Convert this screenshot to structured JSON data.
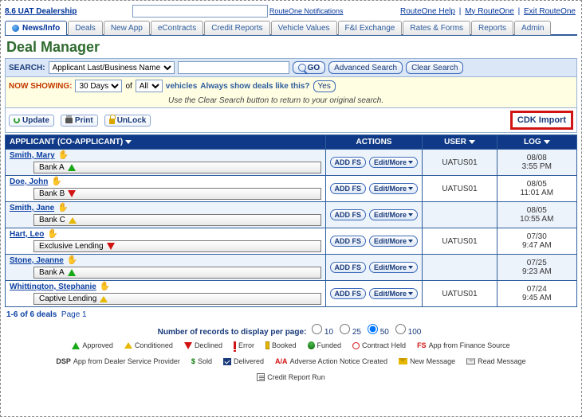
{
  "top": {
    "dealer": "8.6 UAT Dealership",
    "notif_label": "RouteOne Notifications",
    "links": {
      "help": "RouteOne Help",
      "my": "My RouteOne",
      "exit": "Exit RouteOne"
    }
  },
  "tabs": [
    "News/Info",
    "Deals",
    "New App",
    "eContracts",
    "Credit Reports",
    "Vehicle Values",
    "F&I Exchange",
    "Rates & Forms",
    "Reports",
    "Admin"
  ],
  "active_tab": 0,
  "title": "Deal Manager",
  "search": {
    "label": "SEARCH:",
    "field_sel": "Applicant Last/Business Name",
    "go": "GO",
    "advanced": "Advanced Search",
    "clear": "Clear Search"
  },
  "nowshow": {
    "label": "NOW SHOWING:",
    "range": "30 Days",
    "of": "of",
    "filter": "All",
    "vehicles": "vehicles",
    "question": "Always show deals like this?",
    "yes": "Yes",
    "hint": "Use the Clear Search button to return to your original search."
  },
  "actionrow": {
    "update": "Update",
    "print": "Print",
    "unlock": "UnLock",
    "cdk": "CDK Import"
  },
  "headers": {
    "applicant": "APPLICANT (CO-APPLICANT)",
    "actions": "ACTIONS",
    "user": "USER",
    "log": "LOG"
  },
  "action_labels": {
    "addfs": "ADD FS",
    "editmore": "Edit/More"
  },
  "rows": [
    {
      "name": "Smith, Mary",
      "bank": "Bank A",
      "status": "up",
      "user": "UATUS01",
      "date": "08/08",
      "time": "3:55 PM"
    },
    {
      "name": "Doe, John",
      "bank": "Bank B",
      "status": "dn",
      "user": "UATUS01",
      "date": "08/05",
      "time": "11:01 AM"
    },
    {
      "name": "Smith, Jane",
      "bank": "Bank C",
      "status": "cond",
      "user": "",
      "date": "08/05",
      "time": "10:55 AM"
    },
    {
      "name": "Hart, Leo",
      "bank": "Exclusive Lending",
      "status": "dn",
      "user": "UATUS01",
      "date": "07/30",
      "time": "9:47 AM"
    },
    {
      "name": "Stone, Jeanne",
      "bank": "Bank A",
      "status": "up",
      "user": "",
      "date": "07/25",
      "time": "9:23 AM"
    },
    {
      "name": "Whittington, Stephanie",
      "bank": "Captive Lending",
      "status": "cond",
      "user": "UATUS01",
      "date": "07/24",
      "time": "9:45 AM"
    }
  ],
  "pager": {
    "summary": "1-6 of 6 deals",
    "page": "Page 1"
  },
  "records": {
    "label": "Number of records to display per page:",
    "opts": [
      "10",
      "25",
      "50",
      "100"
    ],
    "selected": "50"
  },
  "legend": {
    "approved": "Approved",
    "conditioned": "Conditioned",
    "declined": "Declined",
    "error": "Error",
    "booked": "Booked",
    "funded": "Funded",
    "hold": "Contract Held",
    "fs": "App from Finance Source",
    "dsp": "App from Dealer Service Provider",
    "sold": "Sold",
    "delivered": "Delivered",
    "aa": "Adverse Action Notice Created",
    "newmsg": "New Message",
    "readmsg": "Read Message",
    "crr": "Credit Report Run"
  }
}
